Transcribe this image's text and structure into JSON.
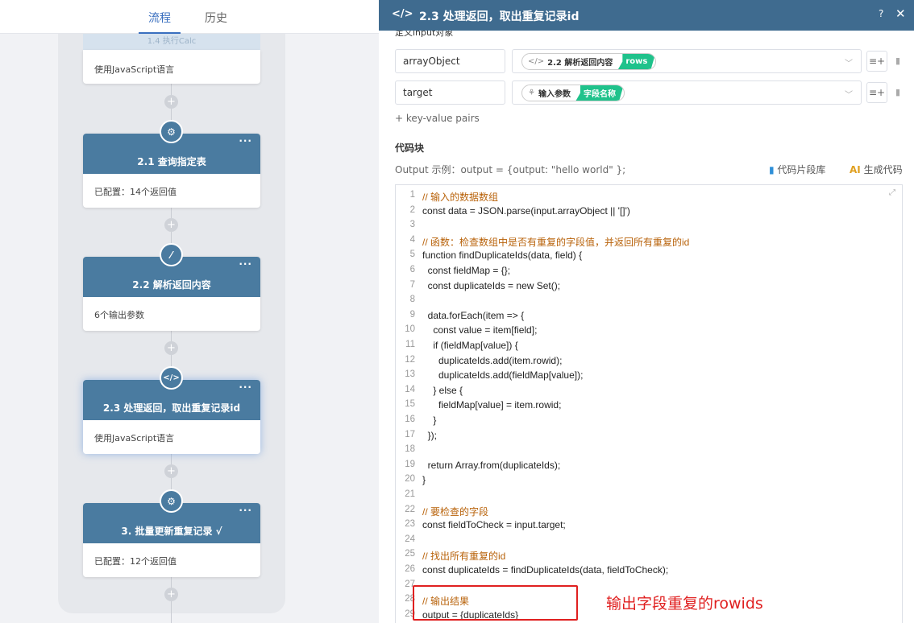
{
  "tabs": {
    "flow": "流程",
    "history": "历史"
  },
  "flow": {
    "top_fragment": "1.4 执行Calc",
    "card0_body": "使用JavaScript语言",
    "nodes": [
      {
        "title": "2.1 查询指定表",
        "body": "已配置：14个返回值",
        "icon": "webhook-icon"
      },
      {
        "title": "2.2 解析返回内容",
        "body": "6个输出参数",
        "icon": "code-icon"
      },
      {
        "title": "2.3 处理返回，取出重复记录id",
        "body": "使用JavaScript语言",
        "icon": "code-icon"
      },
      {
        "title": "3. 批量更新重复记录 √",
        "body": "已配置：12个返回值",
        "icon": "webhook-icon"
      }
    ],
    "dots": "···",
    "plus": "+"
  },
  "panel": {
    "icon": "</>",
    "title": "2.3 处理返回，取出重复记录id",
    "help": "?",
    "close": "✕",
    "section_top": "定义input对象",
    "kv": [
      {
        "key": "arrayObject",
        "chip_icon": "</>",
        "chip_label": "2.2 解析返回内容",
        "chip_value": "rows"
      },
      {
        "key": "target",
        "chip_icon": "⚘",
        "chip_label": "输入参数",
        "chip_value": "字段名称"
      }
    ],
    "add_kv": "+ key-value pairs",
    "code_title": "代码块",
    "example": "Output 示例：output = {output: \"hello world\" };",
    "snippet_lib": "代码片段库",
    "gen_ai": "AI",
    "gen_code": "生成代码"
  },
  "code_lines": [
    "// 输入的数据数组",
    "const data = JSON.parse(input.arrayObject || '[]')",
    "",
    "// 函数：检查数组中是否有重复的字段值，并返回所有重复的id",
    "function findDuplicateIds(data, field) {",
    "  const fieldMap = {};",
    "  const duplicateIds = new Set();",
    "",
    "  data.forEach(item => {",
    "    const value = item[field];",
    "    if (fieldMap[value]) {",
    "      duplicateIds.add(item.rowid);",
    "      duplicateIds.add(fieldMap[value]);",
    "    } else {",
    "      fieldMap[value] = item.rowid;",
    "    }",
    "  });",
    "",
    "  return Array.from(duplicateIds);",
    "}",
    "",
    "// 要检查的字段",
    "const fieldToCheck = input.target;",
    "",
    "// 找出所有重复的id",
    "const duplicateIds = findDuplicateIds(data, fieldToCheck);",
    "",
    "// 输出结果",
    "output = {duplicateIds}"
  ],
  "annotation": "输出字段重复的rowids",
  "colors": {
    "header": "#3f6b8f",
    "node": "#4a7ba0",
    "green": "#1fc28b",
    "annotation": "#e02020"
  }
}
